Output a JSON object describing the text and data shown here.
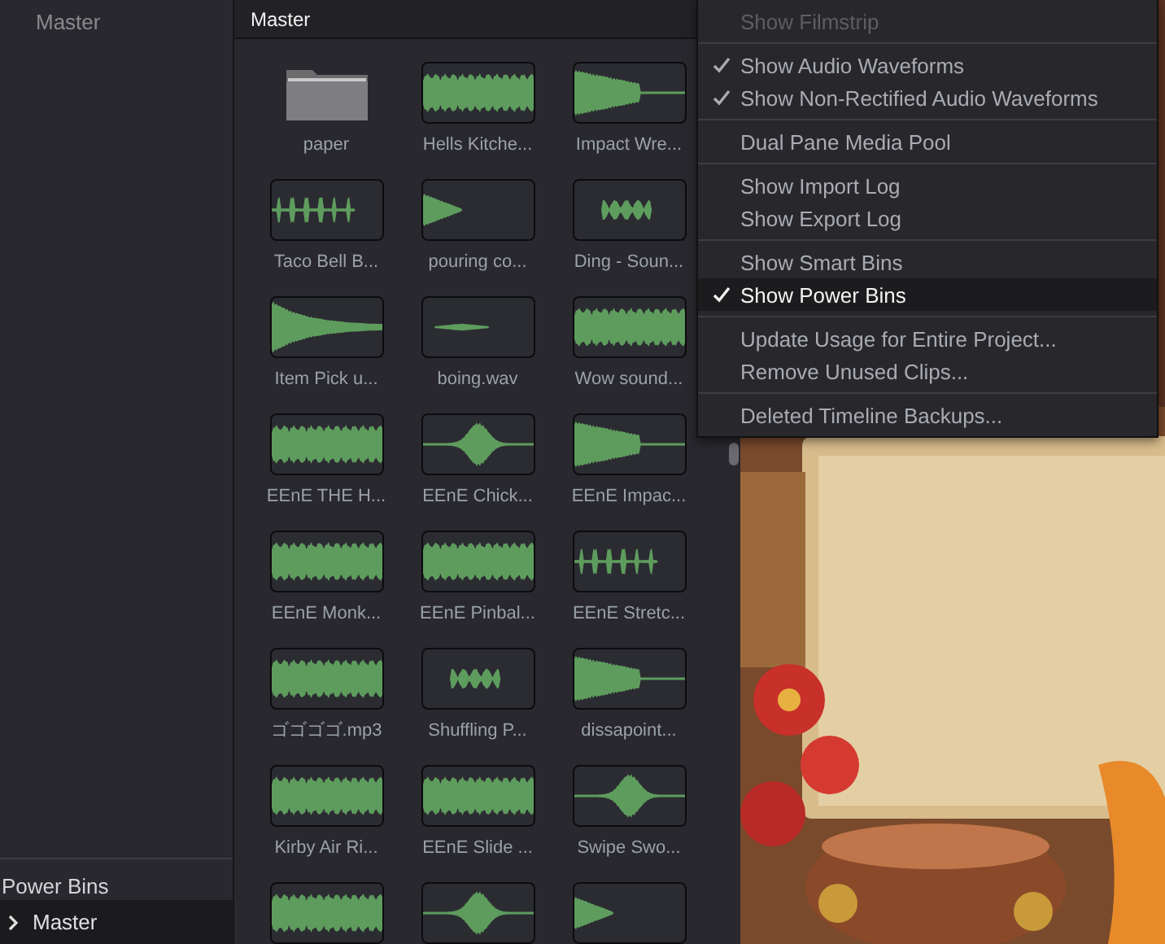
{
  "sidebar": {
    "top_item": "Master",
    "power_bins": {
      "title": "Power Bins",
      "items": [
        {
          "label": "Master",
          "selected": true
        }
      ]
    }
  },
  "media_pool": {
    "title": "Master",
    "clips": [
      {
        "kind": "folder",
        "label": "paper"
      },
      {
        "kind": "audio",
        "label": "Hells Kitche..."
      },
      {
        "kind": "audio",
        "label": "Impact Wre..."
      },
      {
        "kind": "audio",
        "label": "Taco Bell B..."
      },
      {
        "kind": "audio",
        "label": "pouring co..."
      },
      {
        "kind": "audio",
        "label": "Ding - Soun..."
      },
      {
        "kind": "audio",
        "label": "Item Pick u..."
      },
      {
        "kind": "audio",
        "label": "boing.wav"
      },
      {
        "kind": "audio",
        "label": "Wow sound..."
      },
      {
        "kind": "audio",
        "label": "EEnE THE H..."
      },
      {
        "kind": "audio",
        "label": "EEnE Chick..."
      },
      {
        "kind": "audio",
        "label": "EEnE Impac..."
      },
      {
        "kind": "audio",
        "label": "EEnE Monk..."
      },
      {
        "kind": "audio",
        "label": "EEnE Pinbal..."
      },
      {
        "kind": "audio",
        "label": "EEnE Stretc..."
      },
      {
        "kind": "audio",
        "label": "ゴゴゴゴ.mp3"
      },
      {
        "kind": "audio",
        "label": "Shuffling P..."
      },
      {
        "kind": "audio",
        "label": "dissapoint..."
      },
      {
        "kind": "audio",
        "label": "Kirby Air Ri..."
      },
      {
        "kind": "audio",
        "label": "EEnE Slide ..."
      },
      {
        "kind": "audio",
        "label": "Swipe Swo..."
      },
      {
        "kind": "audio"
      },
      {
        "kind": "audio"
      },
      {
        "kind": "audio"
      }
    ]
  },
  "menu": {
    "groups": [
      [
        {
          "label": "Show Filmstrip",
          "checked": false,
          "disabled": true,
          "highlighted": false
        }
      ],
      [
        {
          "label": "Show Audio Waveforms",
          "checked": true,
          "disabled": false,
          "highlighted": false
        },
        {
          "label": "Show Non-Rectified Audio Waveforms",
          "checked": true,
          "disabled": false,
          "highlighted": false
        }
      ],
      [
        {
          "label": "Dual Pane Media Pool",
          "checked": false,
          "disabled": false,
          "highlighted": false
        }
      ],
      [
        {
          "label": "Show Import Log",
          "checked": false,
          "disabled": false,
          "highlighted": false
        },
        {
          "label": "Show Export Log",
          "checked": false,
          "disabled": false,
          "highlighted": false
        }
      ],
      [
        {
          "label": "Show Smart Bins",
          "checked": false,
          "disabled": false,
          "highlighted": false
        },
        {
          "label": "Show Power Bins",
          "checked": true,
          "disabled": false,
          "highlighted": true
        }
      ],
      [
        {
          "label": "Update Usage for Entire Project...",
          "checked": false,
          "disabled": false,
          "highlighted": false
        },
        {
          "label": "Remove Unused Clips...",
          "checked": false,
          "disabled": false,
          "highlighted": false
        }
      ],
      [
        {
          "label": "Deleted Timeline Backups...",
          "checked": false,
          "disabled": false,
          "highlighted": false
        }
      ]
    ]
  }
}
